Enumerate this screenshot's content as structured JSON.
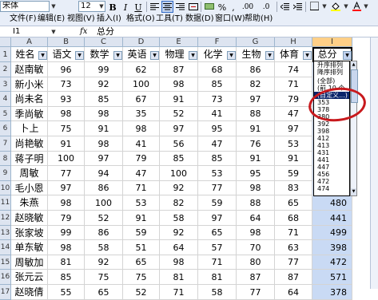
{
  "toolbar": {
    "font_name": "宋体",
    "font_size": "12",
    "bold": "B",
    "italic": "I",
    "underline": "U",
    "currency": "%",
    "comma": ",",
    "decimals": ".00"
  },
  "menu": {
    "items": [
      "文件(F)",
      "编辑(E)",
      "视图(V)",
      "插入(I)",
      "格式(O)",
      "工具(T)",
      "数据(D)",
      "窗口(W)",
      "帮助(H)"
    ]
  },
  "formula_bar": {
    "cell_ref": "I1",
    "fx": "fx",
    "content": "总分"
  },
  "column_letters": [
    "A",
    "B",
    "C",
    "D",
    "E",
    "F",
    "G",
    "H",
    "I"
  ],
  "headers": [
    "姓名",
    "语文",
    "数学",
    "英语",
    "物理",
    "化学",
    "生物",
    "体育",
    "总分"
  ],
  "rows": [
    {
      "n": "2",
      "cells": [
        "赵南敏",
        "96",
        "99",
        "62",
        "87",
        "68",
        "86",
        "74",
        ""
      ]
    },
    {
      "n": "3",
      "cells": [
        "新小米",
        "73",
        "92",
        "100",
        "98",
        "85",
        "82",
        "71",
        ""
      ]
    },
    {
      "n": "4",
      "cells": [
        "尚未名",
        "93",
        "85",
        "67",
        "91",
        "73",
        "97",
        "79",
        ""
      ]
    },
    {
      "n": "5",
      "cells": [
        "季尚敏",
        "98",
        "98",
        "35",
        "52",
        "41",
        "88",
        "47",
        ""
      ]
    },
    {
      "n": "6",
      "cells": [
        "卜上",
        "75",
        "91",
        "98",
        "97",
        "95",
        "91",
        "97",
        ""
      ]
    },
    {
      "n": "7",
      "cells": [
        "尚艳敏",
        "91",
        "98",
        "41",
        "56",
        "47",
        "76",
        "53",
        ""
      ]
    },
    {
      "n": "8",
      "cells": [
        "蒋子明",
        "100",
        "97",
        "79",
        "85",
        "85",
        "91",
        "91",
        ""
      ]
    },
    {
      "n": "9",
      "cells": [
        "周敏",
        "77",
        "94",
        "47",
        "100",
        "53",
        "95",
        "59",
        ""
      ]
    },
    {
      "n": "10",
      "cells": [
        "毛小恩",
        "97",
        "86",
        "71",
        "92",
        "77",
        "98",
        "83",
        ""
      ]
    },
    {
      "n": "11",
      "cells": [
        "朱燕",
        "98",
        "100",
        "53",
        "82",
        "59",
        "88",
        "65",
        "480"
      ]
    },
    {
      "n": "12",
      "cells": [
        "赵晓敏",
        "79",
        "52",
        "91",
        "58",
        "97",
        "64",
        "68",
        "441"
      ]
    },
    {
      "n": "13",
      "cells": [
        "张家坡",
        "99",
        "86",
        "59",
        "92",
        "65",
        "98",
        "71",
        "499"
      ]
    },
    {
      "n": "14",
      "cells": [
        "单东敏",
        "98",
        "58",
        "51",
        "64",
        "57",
        "70",
        "63",
        "398"
      ]
    },
    {
      "n": "15",
      "cells": [
        "周敏加",
        "81",
        "92",
        "65",
        "98",
        "71",
        "80",
        "77",
        "472"
      ]
    },
    {
      "n": "16",
      "cells": [
        "张元云",
        "85",
        "75",
        "75",
        "81",
        "81",
        "87",
        "87",
        "571"
      ]
    },
    {
      "n": "17",
      "cells": [
        "赵晓倩",
        "55",
        "65",
        "52",
        "71",
        "58",
        "77",
        "64",
        "378"
      ]
    }
  ],
  "filter_dropdown": {
    "items": [
      {
        "label": "升序排列",
        "selected": false
      },
      {
        "label": "降序排列",
        "selected": false
      },
      {
        "label": "",
        "selected": false,
        "gap": true
      },
      {
        "label": "(全部)",
        "selected": false
      },
      {
        "label": "(前 10 个...)",
        "selected": false
      },
      {
        "label": "(自定义...)",
        "selected": true
      },
      {
        "label": "353",
        "selected": false
      },
      {
        "label": "378",
        "selected": false
      },
      {
        "label": "380",
        "selected": false
      },
      {
        "label": "392",
        "selected": false
      },
      {
        "label": "398",
        "selected": false
      },
      {
        "label": "412",
        "selected": false
      },
      {
        "label": "413",
        "selected": false
      },
      {
        "label": "431",
        "selected": false
      },
      {
        "label": "441",
        "selected": false
      },
      {
        "label": "447",
        "selected": false
      },
      {
        "label": "456",
        "selected": false
      },
      {
        "label": "472",
        "selected": false
      },
      {
        "label": "474",
        "selected": false
      }
    ]
  },
  "colors": {
    "header_bg": "#dde4f0",
    "selected_col_header": "#ffcf87",
    "selected_cells": "#c9daf4",
    "annotation": "#c8191d"
  }
}
